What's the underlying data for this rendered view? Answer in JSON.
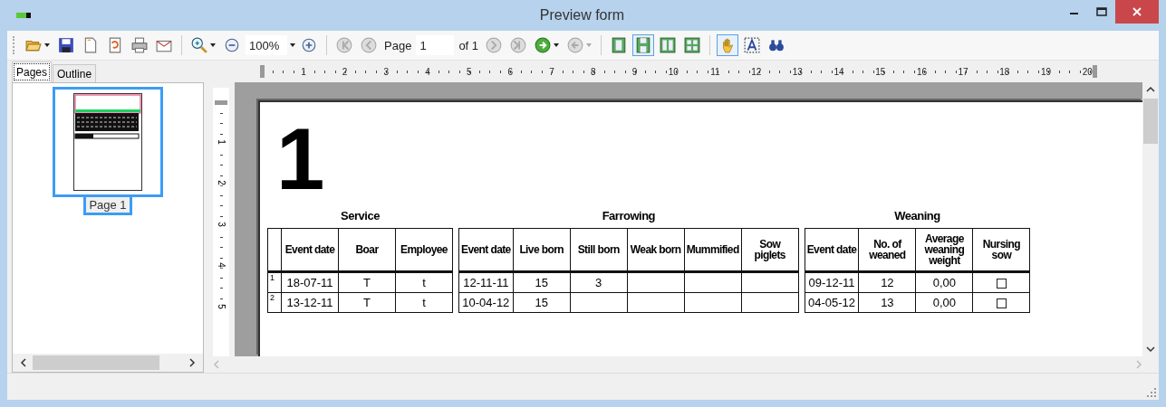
{
  "window": {
    "title": "Preview form"
  },
  "toolbar": [
    {
      "kind": "open",
      "dropdown": true
    },
    {
      "kind": "save"
    },
    {
      "kind": "page"
    },
    {
      "kind": "reload"
    },
    {
      "kind": "print"
    },
    {
      "kind": "mail"
    },
    {
      "kind": "separator"
    },
    {
      "kind": "zoom",
      "dropdown": true
    },
    {
      "kind": "zoom-out"
    },
    {
      "kind": "zoom-field",
      "value": "100%",
      "dropdown": true
    },
    {
      "kind": "zoom-in"
    },
    {
      "kind": "separator"
    },
    {
      "kind": "first",
      "disabled": true
    },
    {
      "kind": "prev",
      "disabled": true
    },
    {
      "kind": "label",
      "text": "Page"
    },
    {
      "kind": "page-field",
      "value": "1"
    },
    {
      "kind": "label",
      "text": "of 1"
    },
    {
      "kind": "next",
      "disabled": true
    },
    {
      "kind": "last",
      "disabled": true
    },
    {
      "kind": "forward",
      "disabled": false,
      "dropdown": true
    },
    {
      "kind": "back",
      "disabled": true,
      "dropdown": true
    },
    {
      "kind": "separator"
    },
    {
      "kind": "one-page",
      "selected": false
    },
    {
      "kind": "continuous",
      "selected": true
    },
    {
      "kind": "two-pages",
      "selected": false
    },
    {
      "kind": "multi-page",
      "selected": false
    },
    {
      "kind": "separator"
    },
    {
      "kind": "hand",
      "selected": true
    },
    {
      "kind": "text-select",
      "selected": false
    },
    {
      "kind": "find"
    }
  ],
  "side_tabs": [
    {
      "label": "Pages",
      "selected": true
    },
    {
      "label": "Outline",
      "selected": false
    }
  ],
  "thumbnails": [
    {
      "label": "Page 1",
      "selected": true
    }
  ],
  "ruler": {
    "horizontal": [
      "1",
      "2",
      "3",
      "4",
      "5",
      "6",
      "7",
      "8",
      "9",
      "10",
      "11",
      "12",
      "13",
      "14",
      "15",
      "16",
      "17",
      "18",
      "19",
      "20"
    ],
    "vertical": [
      "1",
      "2",
      "3",
      "4",
      "5"
    ]
  },
  "page": {
    "number": "1",
    "sections": [
      {
        "title": "Service",
        "columns": [
          {
            "kind": "index"
          },
          {
            "kind": "text",
            "label": "Event date"
          },
          {
            "kind": "text",
            "label": "Boar"
          },
          {
            "kind": "text",
            "label": "Employee"
          }
        ],
        "rows": [
          [
            "1",
            "18-07-11",
            "T",
            "t"
          ],
          [
            "2",
            "13-12-11",
            "T",
            "t"
          ]
        ]
      },
      {
        "title": "Farrowing",
        "columns": [
          {
            "kind": "text",
            "label": "Event date"
          },
          {
            "kind": "text",
            "label": "Live born"
          },
          {
            "kind": "text",
            "label": "Still born"
          },
          {
            "kind": "text",
            "label": "Weak born"
          },
          {
            "kind": "text",
            "label": "Mummified"
          },
          {
            "kind": "text",
            "label": "Sow piglets"
          }
        ],
        "rows": [
          [
            "12-11-11",
            "15",
            "3",
            null,
            null,
            null
          ],
          [
            "10-04-12",
            "15",
            null,
            null,
            null,
            null
          ]
        ]
      },
      {
        "title": "Weaning",
        "columns": [
          {
            "kind": "text",
            "label": "Event date"
          },
          {
            "kind": "text",
            "label": "No. of weaned"
          },
          {
            "kind": "text",
            "label": "Average weaning weight"
          },
          {
            "kind": "checkbox",
            "label": "Nursing sow"
          }
        ],
        "rows": [
          [
            "09-12-11",
            "12",
            "0,00",
            {
              "checked": false
            }
          ],
          [
            "04-05-12",
            "13",
            "0,00",
            {
              "checked": false
            }
          ]
        ]
      }
    ]
  }
}
